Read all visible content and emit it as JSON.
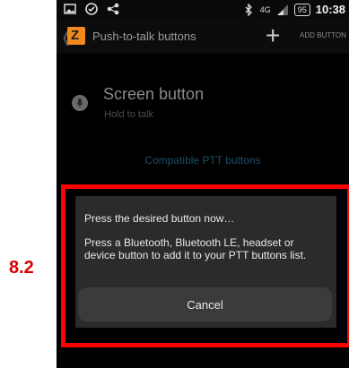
{
  "status_bar": {
    "network": "4G",
    "battery": "95",
    "time": "10:38"
  },
  "app_bar": {
    "title": "Push-to-talk buttons",
    "add_label": "ADD BUTTON"
  },
  "list": {
    "item_title": "Screen button",
    "item_subtitle": "Hold to talk"
  },
  "compatible_link": "Compatible PTT buttons",
  "dialog": {
    "title": "Press the desired button now…",
    "body": "Press a Bluetooth, Bluetooth LE, headset or device button to add it to your PTT buttons list.",
    "cancel_label": "Cancel"
  },
  "annotation": {
    "step": "8.2",
    "color": "#ff0000"
  },
  "colors": {
    "brand": "#f08a1c",
    "link": "#1f4e68",
    "dialog_bg": "#2b2b2b"
  }
}
